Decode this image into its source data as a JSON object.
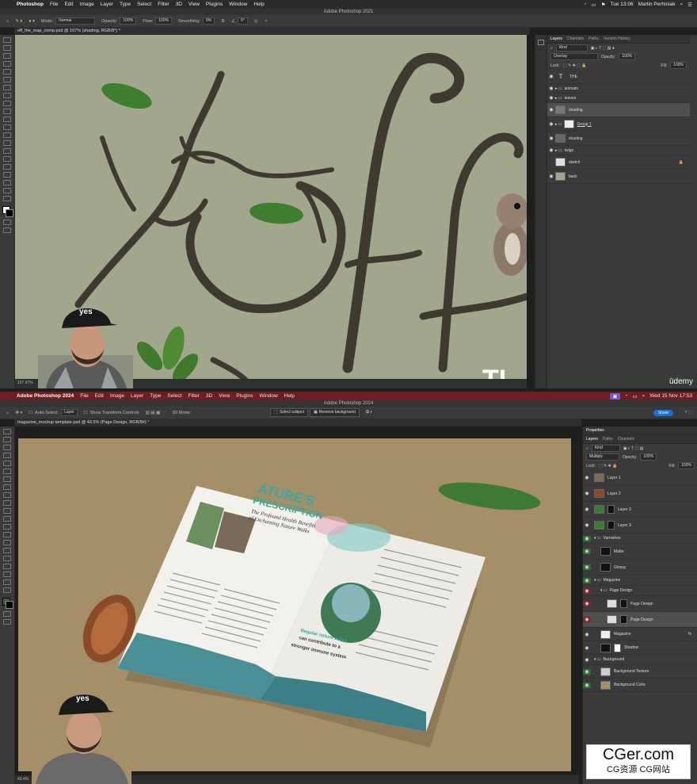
{
  "top": {
    "menubar": {
      "app": "Photoshop",
      "items": [
        "File",
        "Edit",
        "Image",
        "Layer",
        "Type",
        "Select",
        "Filter",
        "3D",
        "View",
        "Plugins",
        "Window",
        "Help"
      ],
      "clock": "Tue 13:06",
      "user": "Martin Perhiniak"
    },
    "title": "Adobe Photoshop 2021",
    "options": {
      "mode_label": "Mode:",
      "mode_value": "Normal",
      "opacity_label": "Opacity:",
      "opacity_value": "100%",
      "flow_label": "Flow:",
      "flow_value": "100%",
      "smoothing_label": "Smoothing:",
      "smoothing_value": "0%",
      "angle_value": "0°"
    },
    "doc_tab": "off_the_map_comp.psd @ 167% (shading, RGB/8*) *",
    "status_zoom": "167.67%",
    "canvas_text": "TI",
    "udemy": "ūdemy",
    "webcam_cap": "yes",
    "panel": {
      "tabs": [
        "Layers",
        "Channels",
        "Paths",
        "Version History"
      ],
      "kind": "Kind",
      "blend": "Overlay",
      "opacity_label": "Opacity:",
      "opacity": "100%",
      "lock_label": "Lock:",
      "fill_label": "Fill:",
      "fill": "100%",
      "layers": [
        "THE",
        "animals",
        "leaves",
        "shading",
        "Group 1",
        "shading",
        "twigs",
        "sketch",
        "back"
      ]
    }
  },
  "bottom": {
    "menubar": {
      "app": "Adobe Photoshop 2024",
      "items": [
        "File",
        "Edit",
        "Image",
        "Layer",
        "Type",
        "Select",
        "Filter",
        "3D",
        "View",
        "Plugins",
        "Window",
        "Help"
      ],
      "clock": "Wed 15 Nov 17:53"
    },
    "title": "Adobe Photoshop 2024",
    "options": {
      "auto_select": "Auto-Select:",
      "auto_value": "Layer",
      "transform": "Show Transform Controls",
      "mode3d": "3D Mode:",
      "select_subject": "Select subject",
      "remove_bg": "Remove background",
      "share": "Share"
    },
    "doc_tab": "magazine_mockup template.psd @ 43.5% (Page Design, RGB/8#) *",
    "status_zoom": "43.4%",
    "webcam_cap": "yes",
    "magazine": {
      "headline1": "ATURE'S",
      "headline2": "PRESCRIPTION",
      "subhead1": "The Profound Health Benefits",
      "subhead2": "of Enchanting Nature Walks",
      "quote1": "Regular nature walks",
      "quote2": "can contribute to a",
      "quote3": "stronger immune system"
    },
    "panel": {
      "props_tab": "Properties",
      "tabs": [
        "Layers",
        "Paths",
        "Channels"
      ],
      "kind": "Kind",
      "blend": "Multiply",
      "opacity_label": "Opacity:",
      "opacity": "100%",
      "lock_label": "Lock:",
      "fill_label": "Fill:",
      "fill": "100%",
      "layers": [
        "Layer 1",
        "Layer 2",
        "Layer 3",
        "Layer 3",
        "Varnishes",
        "Matte",
        "Glossy",
        "Magazine",
        "Page Design",
        "Page Design",
        "Page Design",
        "Magazine",
        "Shadow",
        "Background",
        "Background Texture",
        "Background Color"
      ]
    },
    "watermark": {
      "line1": "CGer.com",
      "line2": "CG资源 CG网站"
    }
  }
}
